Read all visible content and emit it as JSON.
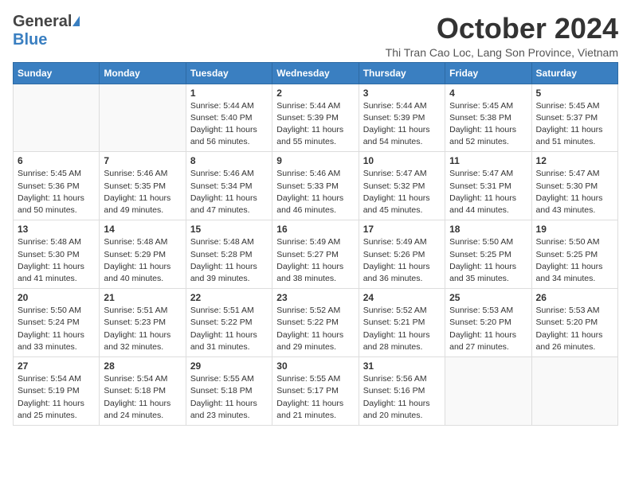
{
  "logo": {
    "general": "General",
    "blue": "Blue"
  },
  "header": {
    "month": "October 2024",
    "location": "Thi Tran Cao Loc, Lang Son Province, Vietnam"
  },
  "days_of_week": [
    "Sunday",
    "Monday",
    "Tuesday",
    "Wednesday",
    "Thursday",
    "Friday",
    "Saturday"
  ],
  "weeks": [
    [
      {
        "day": "",
        "info": ""
      },
      {
        "day": "",
        "info": ""
      },
      {
        "day": "1",
        "info": "Sunrise: 5:44 AM\nSunset: 5:40 PM\nDaylight: 11 hours and 56 minutes."
      },
      {
        "day": "2",
        "info": "Sunrise: 5:44 AM\nSunset: 5:39 PM\nDaylight: 11 hours and 55 minutes."
      },
      {
        "day": "3",
        "info": "Sunrise: 5:44 AM\nSunset: 5:39 PM\nDaylight: 11 hours and 54 minutes."
      },
      {
        "day": "4",
        "info": "Sunrise: 5:45 AM\nSunset: 5:38 PM\nDaylight: 11 hours and 52 minutes."
      },
      {
        "day": "5",
        "info": "Sunrise: 5:45 AM\nSunset: 5:37 PM\nDaylight: 11 hours and 51 minutes."
      }
    ],
    [
      {
        "day": "6",
        "info": "Sunrise: 5:45 AM\nSunset: 5:36 PM\nDaylight: 11 hours and 50 minutes."
      },
      {
        "day": "7",
        "info": "Sunrise: 5:46 AM\nSunset: 5:35 PM\nDaylight: 11 hours and 49 minutes."
      },
      {
        "day": "8",
        "info": "Sunrise: 5:46 AM\nSunset: 5:34 PM\nDaylight: 11 hours and 47 minutes."
      },
      {
        "day": "9",
        "info": "Sunrise: 5:46 AM\nSunset: 5:33 PM\nDaylight: 11 hours and 46 minutes."
      },
      {
        "day": "10",
        "info": "Sunrise: 5:47 AM\nSunset: 5:32 PM\nDaylight: 11 hours and 45 minutes."
      },
      {
        "day": "11",
        "info": "Sunrise: 5:47 AM\nSunset: 5:31 PM\nDaylight: 11 hours and 44 minutes."
      },
      {
        "day": "12",
        "info": "Sunrise: 5:47 AM\nSunset: 5:30 PM\nDaylight: 11 hours and 43 minutes."
      }
    ],
    [
      {
        "day": "13",
        "info": "Sunrise: 5:48 AM\nSunset: 5:30 PM\nDaylight: 11 hours and 41 minutes."
      },
      {
        "day": "14",
        "info": "Sunrise: 5:48 AM\nSunset: 5:29 PM\nDaylight: 11 hours and 40 minutes."
      },
      {
        "day": "15",
        "info": "Sunrise: 5:48 AM\nSunset: 5:28 PM\nDaylight: 11 hours and 39 minutes."
      },
      {
        "day": "16",
        "info": "Sunrise: 5:49 AM\nSunset: 5:27 PM\nDaylight: 11 hours and 38 minutes."
      },
      {
        "day": "17",
        "info": "Sunrise: 5:49 AM\nSunset: 5:26 PM\nDaylight: 11 hours and 36 minutes."
      },
      {
        "day": "18",
        "info": "Sunrise: 5:50 AM\nSunset: 5:25 PM\nDaylight: 11 hours and 35 minutes."
      },
      {
        "day": "19",
        "info": "Sunrise: 5:50 AM\nSunset: 5:25 PM\nDaylight: 11 hours and 34 minutes."
      }
    ],
    [
      {
        "day": "20",
        "info": "Sunrise: 5:50 AM\nSunset: 5:24 PM\nDaylight: 11 hours and 33 minutes."
      },
      {
        "day": "21",
        "info": "Sunrise: 5:51 AM\nSunset: 5:23 PM\nDaylight: 11 hours and 32 minutes."
      },
      {
        "day": "22",
        "info": "Sunrise: 5:51 AM\nSunset: 5:22 PM\nDaylight: 11 hours and 31 minutes."
      },
      {
        "day": "23",
        "info": "Sunrise: 5:52 AM\nSunset: 5:22 PM\nDaylight: 11 hours and 29 minutes."
      },
      {
        "day": "24",
        "info": "Sunrise: 5:52 AM\nSunset: 5:21 PM\nDaylight: 11 hours and 28 minutes."
      },
      {
        "day": "25",
        "info": "Sunrise: 5:53 AM\nSunset: 5:20 PM\nDaylight: 11 hours and 27 minutes."
      },
      {
        "day": "26",
        "info": "Sunrise: 5:53 AM\nSunset: 5:20 PM\nDaylight: 11 hours and 26 minutes."
      }
    ],
    [
      {
        "day": "27",
        "info": "Sunrise: 5:54 AM\nSunset: 5:19 PM\nDaylight: 11 hours and 25 minutes."
      },
      {
        "day": "28",
        "info": "Sunrise: 5:54 AM\nSunset: 5:18 PM\nDaylight: 11 hours and 24 minutes."
      },
      {
        "day": "29",
        "info": "Sunrise: 5:55 AM\nSunset: 5:18 PM\nDaylight: 11 hours and 23 minutes."
      },
      {
        "day": "30",
        "info": "Sunrise: 5:55 AM\nSunset: 5:17 PM\nDaylight: 11 hours and 21 minutes."
      },
      {
        "day": "31",
        "info": "Sunrise: 5:56 AM\nSunset: 5:16 PM\nDaylight: 11 hours and 20 minutes."
      },
      {
        "day": "",
        "info": ""
      },
      {
        "day": "",
        "info": ""
      }
    ]
  ]
}
